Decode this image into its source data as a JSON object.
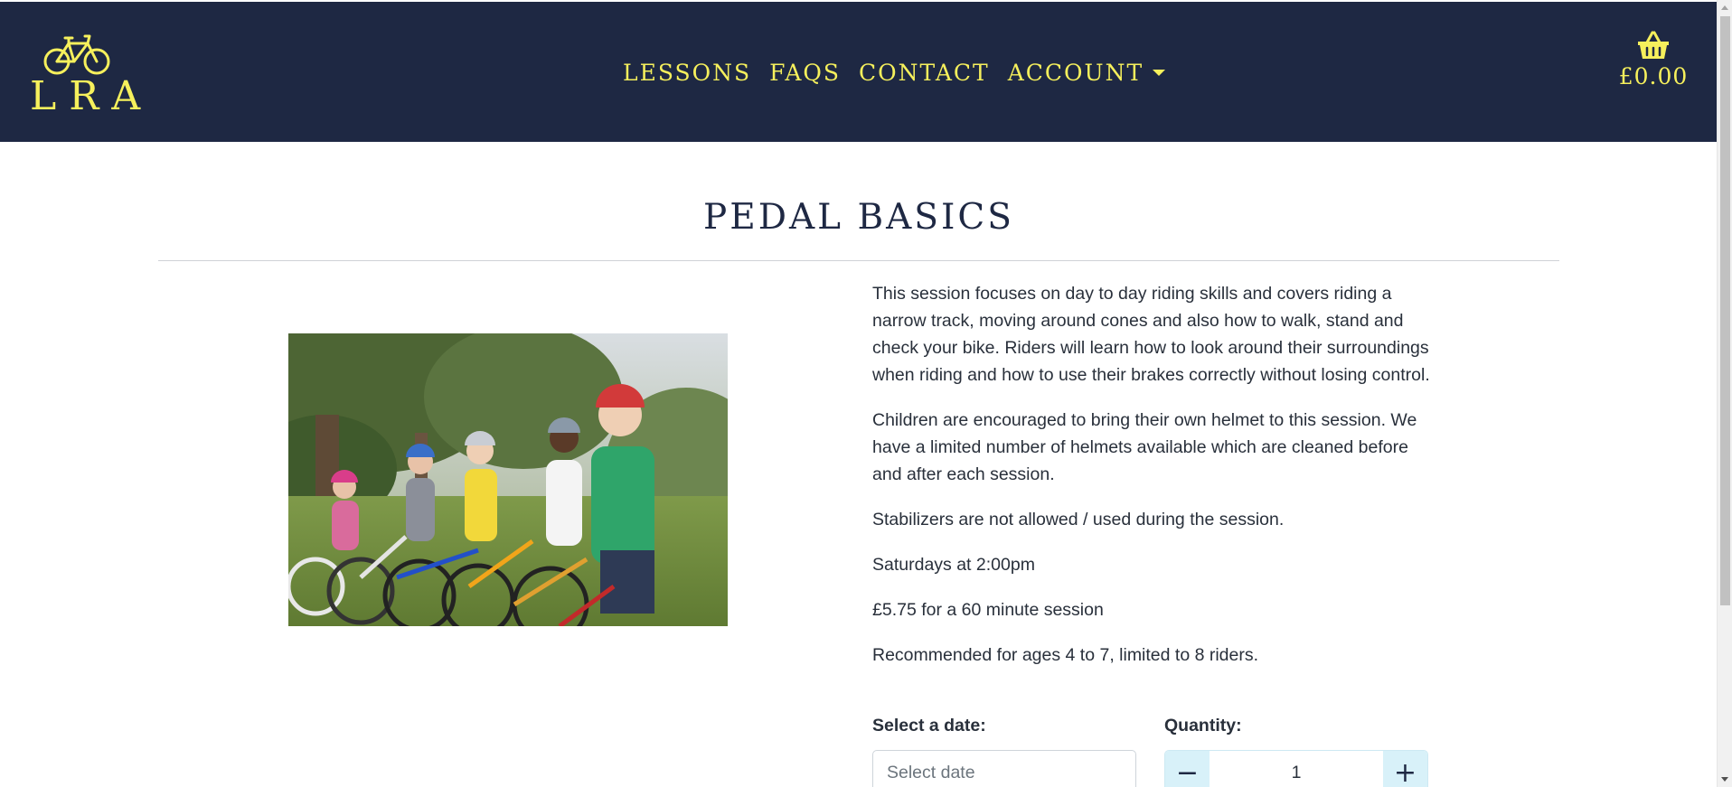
{
  "brand": {
    "logo_text": "LRA",
    "logo_icon": "bicycle-icon",
    "accent_color": "#f6f05c",
    "navbar_color": "#1e2843"
  },
  "nav": {
    "items": [
      {
        "label": "LESSONS"
      },
      {
        "label": "FAQS"
      },
      {
        "label": "CONTACT"
      }
    ],
    "account_label": "ACCOUNT"
  },
  "basket": {
    "icon": "basket-icon",
    "total": "£0.00"
  },
  "product": {
    "title": "PEDAL BASICS",
    "image_alt": "Children on bikes wearing helmets",
    "paragraphs": [
      "This session focuses on day to day riding skills and covers riding a narrow track, moving around cones and also how to walk, stand and check your bike. Riders will learn how to look around their surroundings when riding and how to use their brakes correctly without losing control.",
      "Children are encouraged to bring their own helmet to this session. We have a limited number of helmets available which are cleaned before and after each session.",
      "Stabilizers are not allowed / used during the session.",
      "Saturdays at 2:00pm",
      "£5.75 for a 60 minute session",
      "Recommended for ages 4 to 7, limited to 8 riders."
    ]
  },
  "booking": {
    "date_label": "Select a date:",
    "date_placeholder": "Select date",
    "quantity_label": "Quantity:",
    "quantity_value": "1",
    "decrement_symbol": "−",
    "increment_symbol": "+"
  }
}
